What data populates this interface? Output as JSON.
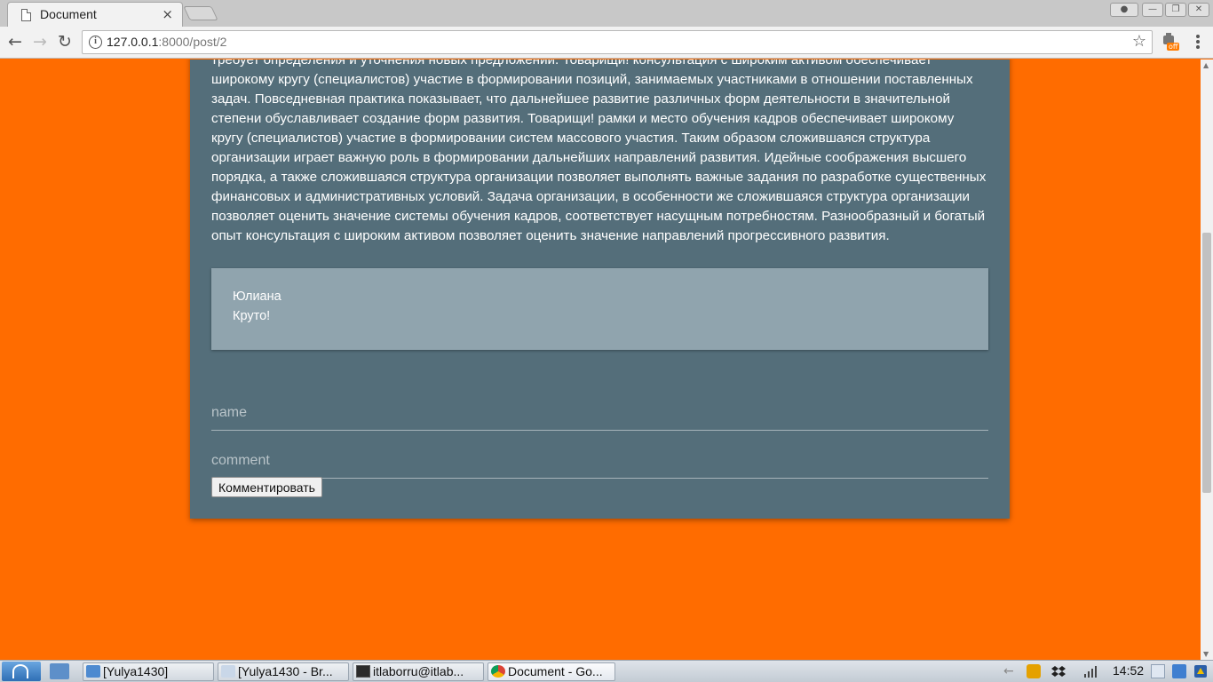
{
  "browser": {
    "tab_title": "Document",
    "tab_close": "×",
    "url_host": "127.0.0.1",
    "url_path": ":8000/post/2",
    "info_glyph": "i",
    "star_glyph": "☆",
    "ext_badge": "off"
  },
  "post": {
    "body": "требует определения и уточнения новых предложений. Товарищи! консультация с широким активом обеспечивает широкому кругу (специалистов) участие в формировании позиций, занимаемых участниками в отношении поставленных задач. Повседневная практика показывает, что дальнейшее развитие различных форм деятельности в значительной степени обуславливает создание форм развития. Товарищи! рамки и место обучения кадров обеспечивает широкому кругу (специалистов) участие в формировании систем массового участия. Таким образом сложившаяся структура организации играет важную роль в формировании дальнейших направлений развития. Идейные соображения высшего порядка, а также сложившаяся структура организации позволяет выполнять важные задания по разработке существенных финансовых и административных условий. Задача организации, в особенности же сложившаяся структура организации позволяет оценить значение системы обучения кадров, соответствует насущным потребностям. Разнообразный и богатый опыт консультация с широким активом позволяет оценить значение направлений прогрессивного развития."
  },
  "comments": [
    {
      "author": "Юлиана",
      "text": "Круто!"
    }
  ],
  "form": {
    "name_placeholder": "name",
    "comment_placeholder": "comment",
    "submit_label": "Комментировать"
  },
  "taskbar": {
    "tasks": [
      {
        "label": "[Yulya1430]"
      },
      {
        "label": "[Yulya1430 - Br..."
      },
      {
        "label": "itlaborru@itlab..."
      },
      {
        "label": "Document - Go..."
      }
    ],
    "clock": "14:52"
  }
}
